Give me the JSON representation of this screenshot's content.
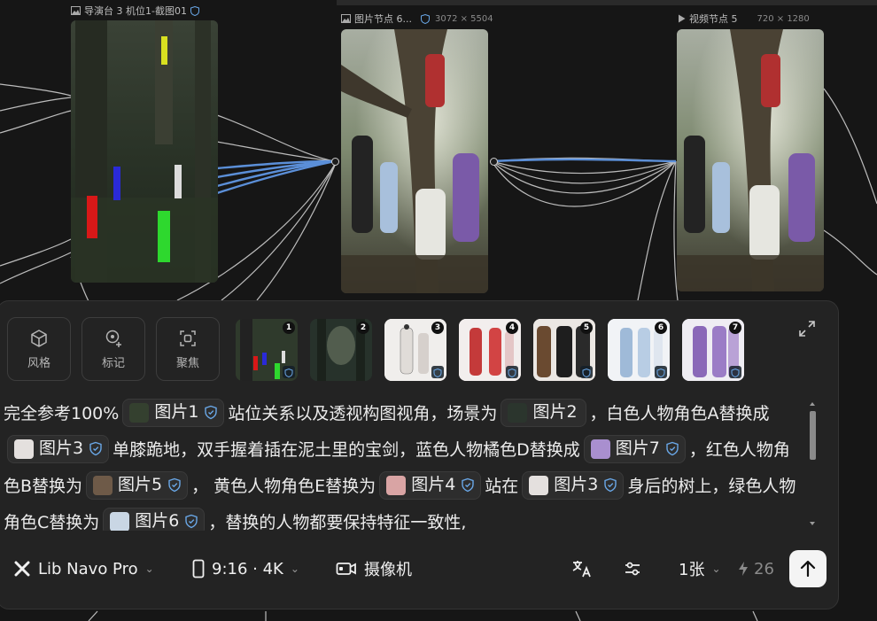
{
  "canvas": {
    "nodes": [
      {
        "id": "n1",
        "title": "导演台 3 机位1-截图01",
        "dims": ""
      },
      {
        "id": "n2",
        "title": "图片节点 6...",
        "dims": "3072 × 5504"
      },
      {
        "id": "n3",
        "title": "视频节点 5",
        "dims": "720 × 1280"
      }
    ]
  },
  "panel": {
    "tools": [
      {
        "label": "风格",
        "icon": "cube-icon"
      },
      {
        "label": "标记",
        "icon": "marker-pin-icon"
      },
      {
        "label": "聚焦",
        "icon": "focus-frame-icon"
      }
    ],
    "thumbnails": [
      {
        "num": "1",
        "bg": "#2f3a2c"
      },
      {
        "num": "2",
        "bg": "#27322b"
      },
      {
        "num": "3",
        "bg": "#e9e5e3"
      },
      {
        "num": "4",
        "bg": "#efe7e6"
      },
      {
        "num": "5",
        "bg": "#d8d2cc"
      },
      {
        "num": "6",
        "bg": "#e8ebef"
      },
      {
        "num": "7",
        "bg": "#e7e3ee"
      }
    ],
    "prompt": {
      "t1": "完全参考100%",
      "c1": "图片1",
      "t2": "站位关系以及透视构图视角，场景为",
      "c2": "图片2",
      "t3": "，白色人物角色A替换成",
      "c3": "图片3",
      "t4": "单膝跪地，双手握着插在泥土里的宝剑，蓝色人物橘色D替换成",
      "c4": "图片7",
      "t5": "，红色人物角色B替换为",
      "c5": "图片5",
      "t6": "，  黄色人物角色E替换为",
      "c6": "图片4",
      "t7": "站在",
      "c7": "图片3",
      "t8": "身后的树上，绿色人物角色C替换为",
      "c8": "图片6",
      "t9": "，替换的人物都要保持特征一致性,"
    },
    "bottom": {
      "model": "Lib Navo Pro",
      "ratio": "9:16 · 4K",
      "camera": "摄像机",
      "count": "1张",
      "credits": "26"
    },
    "colors": {
      "accent": "#5b8fd8",
      "panel": "#232323",
      "chip": "#2d2d2d"
    }
  }
}
